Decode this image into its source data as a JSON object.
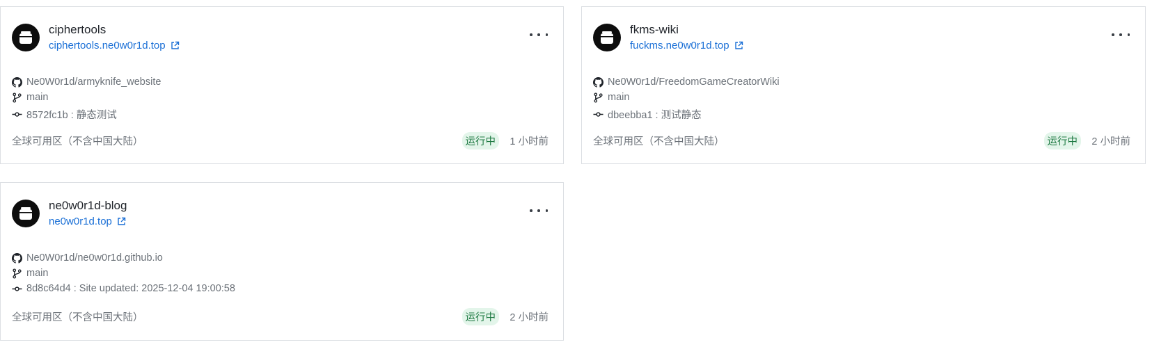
{
  "sites": [
    {
      "name": "ciphertools",
      "domain": "ciphertools.ne0w0r1d.top",
      "repo": "Ne0W0r1d/armyknife_website",
      "branch": "main",
      "commit": "8572fc1b : 静态测试",
      "region": "全球可用区（不含中国大陆）",
      "status": "运行中",
      "updated": "1 小时前"
    },
    {
      "name": "fkms-wiki",
      "domain": "fuckms.ne0w0r1d.top",
      "repo": "Ne0W0r1d/FreedomGameCreatorWiki",
      "branch": "main",
      "commit": "dbeebba1 : 测试静态",
      "region": "全球可用区（不含中国大陆）",
      "status": "运行中",
      "updated": "2 小时前"
    },
    {
      "name": "ne0w0r1d-blog",
      "domain": "ne0w0r1d.top",
      "repo": "Ne0W0r1d/ne0w0r1d.github.io",
      "branch": "main",
      "commit": "8d8c64d4 : Site updated: 2025-12-04 19:00:58",
      "region": "全球可用区（不含中国大陆）",
      "status": "运行中",
      "updated": "2 小时前"
    }
  ],
  "icons": {
    "avatar": "site-logo-icon",
    "external": "external-link-icon",
    "more": "more-options-icon",
    "repo": "github-icon",
    "branch": "git-branch-icon",
    "commit": "git-commit-icon"
  },
  "colors": {
    "link": "#1a6fd6",
    "status_text": "#1f7a43",
    "status_bg": "#e3f5ea",
    "muted": "#6b7178"
  }
}
